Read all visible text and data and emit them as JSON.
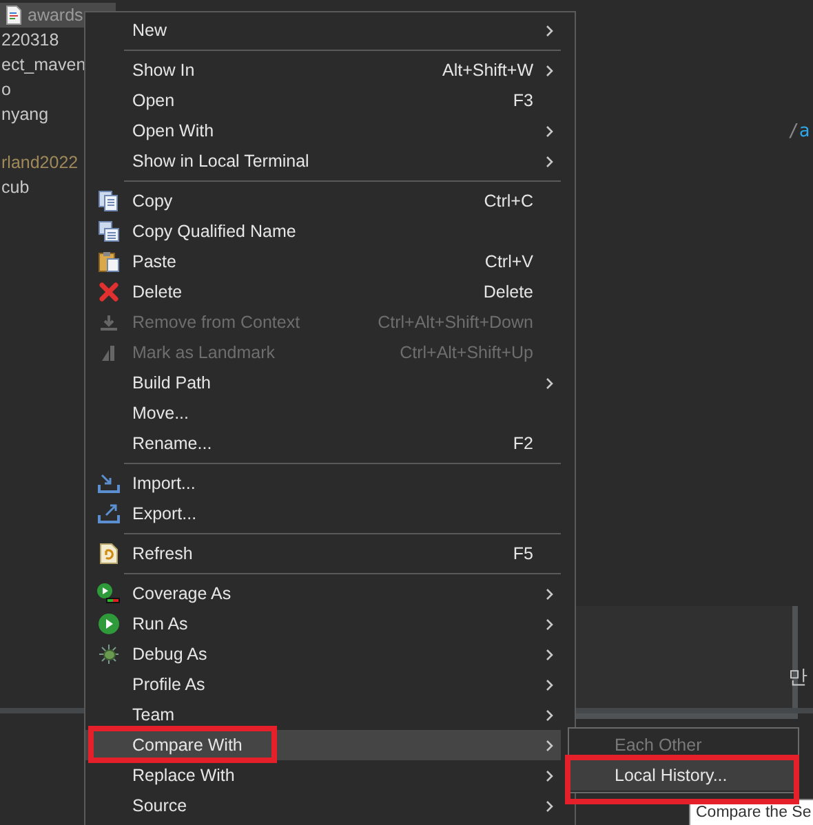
{
  "tree": [
    {
      "label": "awards",
      "selected": true
    },
    {
      "label": "220318",
      "selected": false
    },
    {
      "label": "ect_maven",
      "selected": false
    },
    {
      "label": "o",
      "selected": false
    },
    {
      "label": "nyang",
      "selected": false
    },
    {
      "label": "rland2022",
      "selected": false,
      "muted": true
    },
    {
      "label": "cub",
      "selected": false
    }
  ],
  "editor_fragments": [
    {
      "kind": "path",
      "text": "/",
      "accent": "a"
    },
    {
      "kind": "korean",
      "text": "만"
    }
  ],
  "context_menu": [
    {
      "kind": "item",
      "label": "New",
      "submenu": true
    },
    {
      "kind": "separator"
    },
    {
      "kind": "item",
      "label": "Show In",
      "shortcut": "Alt+Shift+W",
      "submenu": true
    },
    {
      "kind": "item",
      "label": "Open",
      "shortcut": "F3"
    },
    {
      "kind": "item",
      "label": "Open With",
      "submenu": true
    },
    {
      "kind": "item",
      "label": "Show in Local Terminal",
      "submenu": true
    },
    {
      "kind": "separator"
    },
    {
      "kind": "item",
      "label": "Copy",
      "shortcut": "Ctrl+C"
    },
    {
      "kind": "item",
      "label": "Copy Qualified Name"
    },
    {
      "kind": "item",
      "label": "Paste",
      "shortcut": "Ctrl+V"
    },
    {
      "kind": "item",
      "label": "Delete",
      "shortcut": "Delete"
    },
    {
      "kind": "item",
      "label": "Remove from Context",
      "shortcut": "Ctrl+Alt+Shift+Down",
      "disabled": true
    },
    {
      "kind": "item",
      "label": "Mark as Landmark",
      "shortcut": "Ctrl+Alt+Shift+Up",
      "disabled": true
    },
    {
      "kind": "item",
      "label": "Build Path",
      "submenu": true
    },
    {
      "kind": "item",
      "label": "Move..."
    },
    {
      "kind": "item",
      "label": "Rename...",
      "shortcut": "F2"
    },
    {
      "kind": "separator"
    },
    {
      "kind": "item",
      "label": "Import..."
    },
    {
      "kind": "item",
      "label": "Export..."
    },
    {
      "kind": "separator"
    },
    {
      "kind": "item",
      "label": "Refresh",
      "shortcut": "F5"
    },
    {
      "kind": "separator"
    },
    {
      "kind": "item",
      "label": "Coverage As",
      "submenu": true
    },
    {
      "kind": "item",
      "label": "Run As",
      "submenu": true
    },
    {
      "kind": "item",
      "label": "Debug As",
      "submenu": true
    },
    {
      "kind": "item",
      "label": "Profile As",
      "submenu": true
    },
    {
      "kind": "item",
      "label": "Team",
      "submenu": true
    },
    {
      "kind": "item",
      "label": "Compare With",
      "submenu": true,
      "selected": true,
      "highlighted_box": true
    },
    {
      "kind": "item",
      "label": "Replace With",
      "submenu": true
    },
    {
      "kind": "item",
      "label": "Source",
      "submenu": true
    }
  ],
  "submenu": [
    {
      "label": "Each Other",
      "disabled": true,
      "selected": false
    },
    {
      "label": "Local History...",
      "disabled": false,
      "selected": true,
      "highlighted_box": true
    }
  ],
  "tooltip": {
    "text": "Compare the Se"
  }
}
